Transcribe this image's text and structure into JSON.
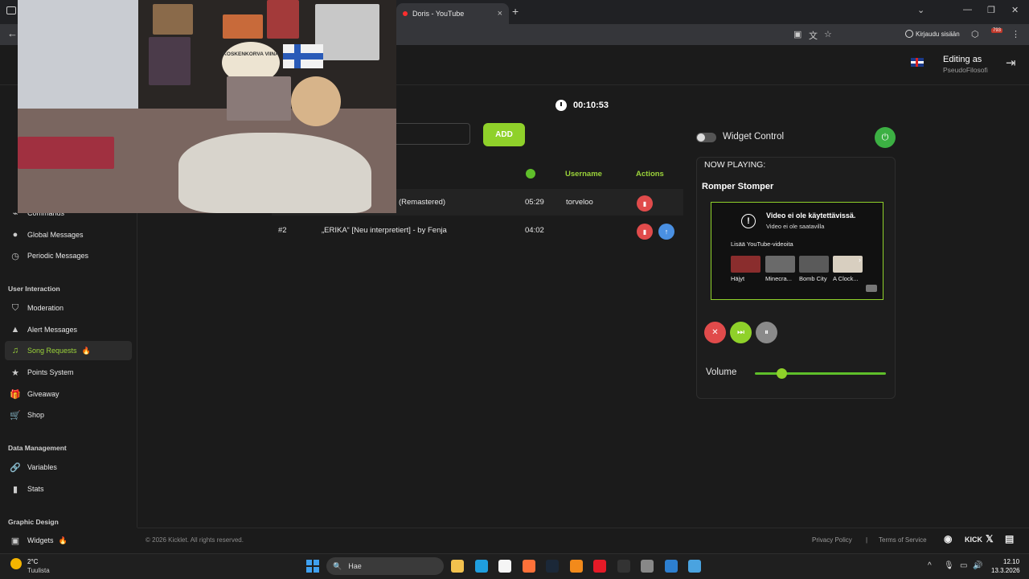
{
  "browser": {
    "active_tab_title": "Doris - YouTube",
    "tab_close": "×",
    "new_tab": "+",
    "tab_list": "⌄",
    "window_controls": [
      "—",
      "❐",
      "✕"
    ],
    "back": "←",
    "sign_in_label": "Kirjaudu sisään",
    "extension_badge": "793"
  },
  "header": {
    "editing_label": "Editing as",
    "editing_user": "PseudoFilosofi",
    "logout": "⇥"
  },
  "sidebar": {
    "items": [
      {
        "label": "Commands",
        "icon": "terminal-icon",
        "glyph": "⌁"
      },
      {
        "label": "Global Messages",
        "icon": "chat-icon",
        "glyph": "●"
      },
      {
        "label": "Periodic Messages",
        "icon": "clock-icon",
        "glyph": "◷"
      }
    ],
    "sections": [
      {
        "heading": "User Interaction",
        "items": [
          {
            "label": "Moderation",
            "icon": "shield-icon",
            "glyph": "⛉"
          },
          {
            "label": "Alert Messages",
            "icon": "warning-icon",
            "glyph": "▲"
          },
          {
            "label": "Song Requests",
            "icon": "music-icon",
            "glyph": "♫",
            "active": true,
            "badge": "🔥"
          },
          {
            "label": "Points System",
            "icon": "star-icon",
            "glyph": "★"
          },
          {
            "label": "Giveaway",
            "icon": "gift-icon",
            "glyph": "🎁"
          },
          {
            "label": "Shop",
            "icon": "cart-icon",
            "glyph": "🛒"
          }
        ]
      },
      {
        "heading": "Data Management",
        "items": [
          {
            "label": "Variables",
            "icon": "link-icon",
            "glyph": "🔗"
          },
          {
            "label": "Stats",
            "icon": "bar-chart-icon",
            "glyph": "▮"
          }
        ]
      },
      {
        "heading": "Graphic Design",
        "items": [
          {
            "label": "Widgets",
            "icon": "widgets-icon",
            "glyph": "▣",
            "badge": "🔥"
          }
        ]
      }
    ]
  },
  "main": {
    "timer": "00:10:53",
    "add_button": "ADD",
    "columns": {
      "username": "Username",
      "actions": "Actions"
    },
    "rows": [
      {
        "index": "",
        "title": "(Remastered)",
        "duration": "05:29",
        "username": "torveloo",
        "delete": "▮",
        "up": ""
      },
      {
        "index": "#2",
        "title": "„ERIKA“ [Neu interpretiert] - by Fenja",
        "duration": "04:02",
        "username": "",
        "delete": "▮",
        "up": "↑"
      }
    ]
  },
  "widget": {
    "control_label": "Widget Control",
    "power": "⏻",
    "now_playing_label": "NOW PLAYING:",
    "now_playing_title": "Romper Stomper",
    "youtube": {
      "error_title": "Video ei ole käytettävissä.",
      "error_sub": "Video ei ole saatavilla",
      "more_label": "Lisää YouTube-videoita",
      "next": "›",
      "thumbnails": [
        {
          "label": "Häjyt",
          "color": "#8a2d2d"
        },
        {
          "label": "Minecra...",
          "color": "#6a6a6a"
        },
        {
          "label": "Bomb City",
          "color": "#5a5a5a"
        },
        {
          "label": "A Clock...",
          "color": "#d8cfc0"
        }
      ]
    },
    "controls": {
      "stop": "✕",
      "skip": "⏭",
      "pause": "⏸"
    },
    "volume_label": "Volume",
    "volume_level": 0.2
  },
  "footer": {
    "copyright": "© 2026 Kicklet. All rights reserved.",
    "privacy": "Privacy Policy",
    "separator": "|",
    "terms": "Terms of Service",
    "social": [
      "◉",
      "KICK",
      "𝕏",
      "▤"
    ]
  },
  "webcam": {
    "sign_text": "KOSKENKORVA VIINA"
  },
  "taskbar": {
    "temperature": "2°C",
    "weather": "Tuulista",
    "search_placeholder": "Hae",
    "search_icon": "🔍",
    "apps": [
      {
        "name": "file-explorer-icon",
        "color": "#f2c14e"
      },
      {
        "name": "edge-icon",
        "color": "#1f9ede"
      },
      {
        "name": "store-icon",
        "color": "#f5f5f5"
      },
      {
        "name": "firefox-icon",
        "color": "#ff7139"
      },
      {
        "name": "steam-icon",
        "color": "#1b2838"
      },
      {
        "name": "vlc-icon",
        "color": "#f28a1b"
      },
      {
        "name": "opera-icon",
        "color": "#e51a27"
      },
      {
        "name": "terminal-icon",
        "color": "#333333"
      },
      {
        "name": "settings-icon",
        "color": "#888888"
      },
      {
        "name": "paint-icon",
        "color": "#2d7fd0"
      },
      {
        "name": "app-icon",
        "color": "#4aa3e0"
      }
    ],
    "tray": [
      "^",
      "🎙",
      "▭",
      "🔊"
    ],
    "time": "12.10",
    "date": "13.3.2026"
  }
}
